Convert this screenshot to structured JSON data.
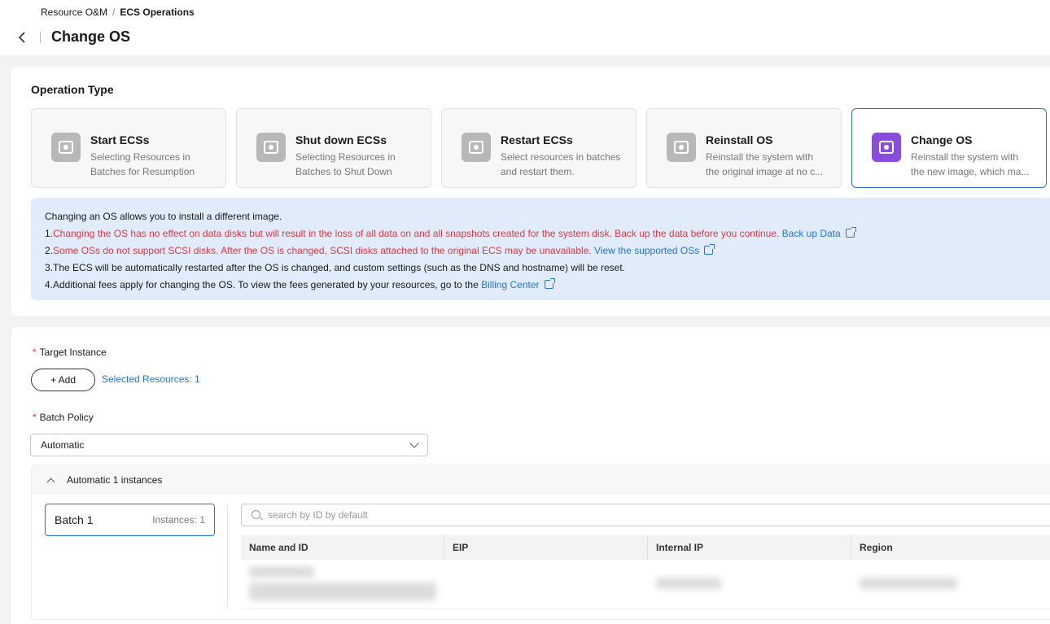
{
  "breadcrumb": {
    "root": "Resource O&M",
    "separator": "/",
    "current": "ECS Operations"
  },
  "page": {
    "title": "Change OS"
  },
  "operation": {
    "section_title": "Operation Type",
    "types": [
      {
        "title": "Start ECSs",
        "desc1": "Selecting Resources in",
        "desc2": "Batches for Resumption",
        "icon": "start-icon"
      },
      {
        "title": "Shut down ECSs",
        "desc1": "Selecting Resources in",
        "desc2": "Batches to Shut Down",
        "icon": "shutdown-icon"
      },
      {
        "title": "Restart ECSs",
        "desc1": "Select resources in batches",
        "desc2": "and restart them.",
        "icon": "restart-icon"
      },
      {
        "title": "Reinstall OS",
        "desc1": "Reinstall the system with",
        "desc2": "the original image at no c...",
        "icon": "reinstall-icon"
      },
      {
        "title": "Change OS",
        "desc1": "Reinstall the system with",
        "desc2": "the new image, which ma...",
        "icon": "change-os-icon",
        "selected": true
      }
    ]
  },
  "notice": {
    "intro": "Changing an OS allows you to install a different image.",
    "line1_prefix": "1.",
    "line1_red": "Changing the OS has no effect on data disks but will result in the loss of all data on and all snapshots created for the system disk. Back up the data before you continue.",
    "line1_link": "Back up Data",
    "line2_prefix": "2.",
    "line2_red": "Some OSs do not support SCSI disks. After the OS is changed, SCSI disks attached to the original ECS may be unavailable.",
    "line2_link": "View the supported OSs",
    "line3": "3.The ECS will be automatically restarted after the OS is changed, and custom settings (such as the DNS and hostname) will be reset.",
    "line4_text": "4.Additional fees apply for changing the OS. To view the fees generated by your resources, go to the",
    "line4_link": "Billing Center"
  },
  "form": {
    "required_mark": "*",
    "target_label": "Target Instance",
    "add_label": "+ Add",
    "selected_resources": "Selected Resources: 1",
    "batch_label": "Batch Policy",
    "batch_policy_value": "Automatic"
  },
  "batches": {
    "header": "Automatic 1 instances",
    "items": [
      {
        "name": "Batch 1",
        "count": "Instances: 1"
      }
    ],
    "search_placeholder": "search by ID by default",
    "columns": [
      "Name and ID",
      "EIP",
      "Internal IP",
      "Region"
    ]
  },
  "colors": {
    "accent": "#2673dd",
    "warning": "#e6333f",
    "selected_icon": "#8a4bdf",
    "notice_bg": "#e1ecfb"
  }
}
